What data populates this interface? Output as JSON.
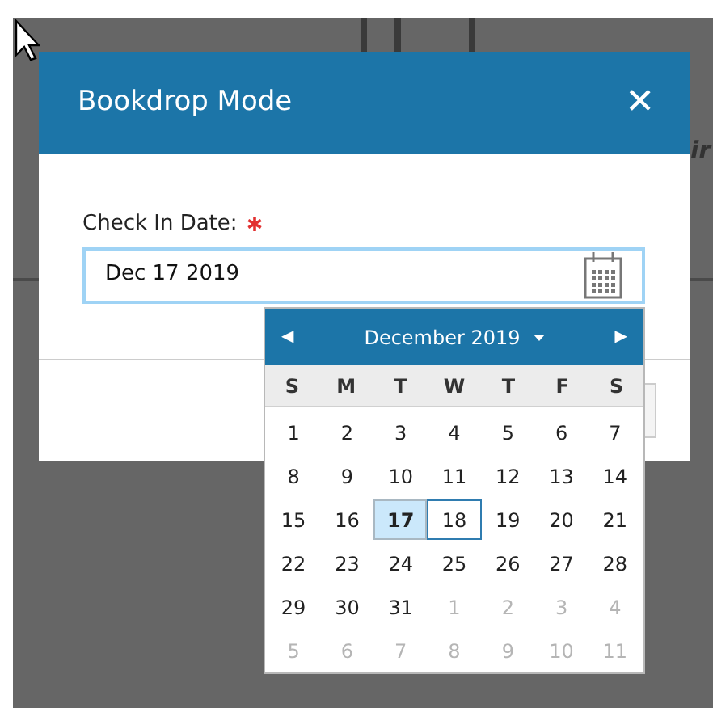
{
  "background": {
    "partial_text": "ir"
  },
  "dialog": {
    "title": "Bookdrop Mode",
    "close": "✕",
    "field": {
      "label": "Check In Date:",
      "required": true,
      "value": "Dec 17 2019"
    }
  },
  "calendar": {
    "prev": "◀",
    "next": "▶",
    "month_title": "December 2019",
    "weekdays": [
      "S",
      "M",
      "T",
      "W",
      "T",
      "F",
      "S"
    ],
    "weeks": [
      [
        {
          "day": "1",
          "muted": false,
          "selected": false,
          "focused": false
        },
        {
          "day": "2",
          "muted": false,
          "selected": false,
          "focused": false
        },
        {
          "day": "3",
          "muted": false,
          "selected": false,
          "focused": false
        },
        {
          "day": "4",
          "muted": false,
          "selected": false,
          "focused": false
        },
        {
          "day": "5",
          "muted": false,
          "selected": false,
          "focused": false
        },
        {
          "day": "6",
          "muted": false,
          "selected": false,
          "focused": false
        },
        {
          "day": "7",
          "muted": false,
          "selected": false,
          "focused": false
        }
      ],
      [
        {
          "day": "8",
          "muted": false,
          "selected": false,
          "focused": false
        },
        {
          "day": "9",
          "muted": false,
          "selected": false,
          "focused": false
        },
        {
          "day": "10",
          "muted": false,
          "selected": false,
          "focused": false
        },
        {
          "day": "11",
          "muted": false,
          "selected": false,
          "focused": false
        },
        {
          "day": "12",
          "muted": false,
          "selected": false,
          "focused": false
        },
        {
          "day": "13",
          "muted": false,
          "selected": false,
          "focused": false
        },
        {
          "day": "14",
          "muted": false,
          "selected": false,
          "focused": false
        }
      ],
      [
        {
          "day": "15",
          "muted": false,
          "selected": false,
          "focused": false
        },
        {
          "day": "16",
          "muted": false,
          "selected": false,
          "focused": false
        },
        {
          "day": "17",
          "muted": false,
          "selected": true,
          "focused": false
        },
        {
          "day": "18",
          "muted": false,
          "selected": false,
          "focused": true
        },
        {
          "day": "19",
          "muted": false,
          "selected": false,
          "focused": false
        },
        {
          "day": "20",
          "muted": false,
          "selected": false,
          "focused": false
        },
        {
          "day": "21",
          "muted": false,
          "selected": false,
          "focused": false
        }
      ],
      [
        {
          "day": "22",
          "muted": false,
          "selected": false,
          "focused": false
        },
        {
          "day": "23",
          "muted": false,
          "selected": false,
          "focused": false
        },
        {
          "day": "24",
          "muted": false,
          "selected": false,
          "focused": false
        },
        {
          "day": "25",
          "muted": false,
          "selected": false,
          "focused": false
        },
        {
          "day": "26",
          "muted": false,
          "selected": false,
          "focused": false
        },
        {
          "day": "27",
          "muted": false,
          "selected": false,
          "focused": false
        },
        {
          "day": "28",
          "muted": false,
          "selected": false,
          "focused": false
        }
      ],
      [
        {
          "day": "29",
          "muted": false,
          "selected": false,
          "focused": false
        },
        {
          "day": "30",
          "muted": false,
          "selected": false,
          "focused": false
        },
        {
          "day": "31",
          "muted": false,
          "selected": false,
          "focused": false
        },
        {
          "day": "1",
          "muted": true,
          "selected": false,
          "focused": false
        },
        {
          "day": "2",
          "muted": true,
          "selected": false,
          "focused": false
        },
        {
          "day": "3",
          "muted": true,
          "selected": false,
          "focused": false
        },
        {
          "day": "4",
          "muted": true,
          "selected": false,
          "focused": false
        }
      ],
      [
        {
          "day": "5",
          "muted": true,
          "selected": false,
          "focused": false
        },
        {
          "day": "6",
          "muted": true,
          "selected": false,
          "focused": false
        },
        {
          "day": "7",
          "muted": true,
          "selected": false,
          "focused": false
        },
        {
          "day": "8",
          "muted": true,
          "selected": false,
          "focused": false
        },
        {
          "day": "9",
          "muted": true,
          "selected": false,
          "focused": false
        },
        {
          "day": "10",
          "muted": true,
          "selected": false,
          "focused": false
        },
        {
          "day": "11",
          "muted": true,
          "selected": false,
          "focused": false
        }
      ]
    ]
  }
}
